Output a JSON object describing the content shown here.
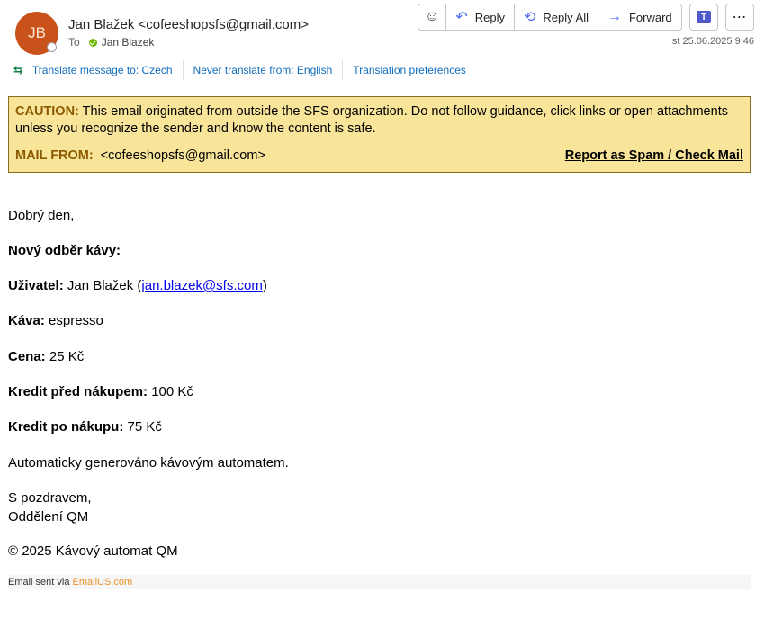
{
  "header": {
    "avatar_initials": "JB",
    "sender": "Jan Blažek <cofeeshopsfs@gmail.com>",
    "to_label": "To",
    "recipient": "Jan Blazek",
    "date": "st 25.06.2025 9:46"
  },
  "actions": {
    "emoji_icon": "smiley-icon",
    "reply": "Reply",
    "reply_all": "Reply All",
    "forward": "Forward",
    "teams_icon": "teams-icon",
    "more_icon": "more-icon"
  },
  "translate": {
    "translate_to": "Translate message to: Czech",
    "never_translate": "Never translate from: English",
    "preferences": "Translation preferences"
  },
  "caution": {
    "label": "CAUTION:",
    "text": " This email originated from outside the SFS organization. Do not follow guidance, click links or open attachments unless you recognize the sender and know the content is safe.",
    "mail_from_label": "MAIL FROM:",
    "mail_from_value": "<cofeeshopsfs@gmail.com>",
    "report_link": "Report as Spam / Check Mail",
    "bg_color": "#f9e59a"
  },
  "message": {
    "greeting": "Dobrý den,",
    "heading": "Nový odběr kávy:",
    "user_label": "Uživatel:",
    "user_name": " Jan Blažek (",
    "user_email": "jan.blazek@sfs.com",
    "user_close": ")",
    "coffee_label": "Káva:",
    "coffee_value": " espresso",
    "price_label": "Cena:",
    "price_value": " 25 Kč",
    "credit_before_label": "Kredit před nákupem:",
    "credit_before_value": " 100 Kč",
    "credit_after_label": "Kredit po nákupu:",
    "credit_after_value": " 75 Kč",
    "auto_note": "Automaticky generováno kávovým automatem.",
    "closing": "S pozdravem,",
    "department": "Oddělení QM",
    "copyright": "© 2025 Kávový automat QM"
  },
  "footer": {
    "sent_via": "Email sent via ",
    "service": "EmailUS.com"
  }
}
